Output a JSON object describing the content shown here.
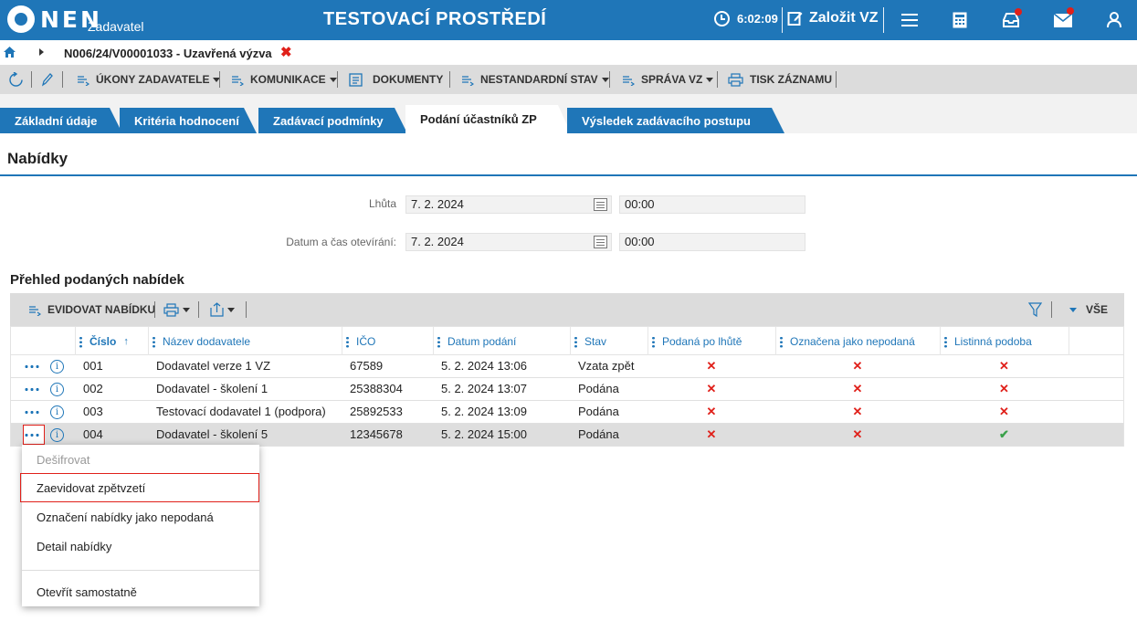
{
  "header": {
    "logo_text": "NEN",
    "logo_sub": "Zadavatel",
    "env_title": "TESTOVACÍ PROSTŘEDÍ",
    "time": "6:02:09",
    "create_label": "Založit VZ"
  },
  "breadcrumb": {
    "text": "N006/24/V00001033 - Uzavřená výzva",
    "close": "✖"
  },
  "toolbar": {
    "ukony": "ÚKONY ZADAVATELE",
    "komunikace": "KOMUNIKACE",
    "dokumenty": "DOKUMENTY",
    "nestandardni": "NESTANDARDNÍ STAV",
    "sprava": "SPRÁVA VZ",
    "tisk": "TISK ZÁZNAMU"
  },
  "tabs": [
    {
      "label": "Základní údaje"
    },
    {
      "label": "Kritéria hodnocení"
    },
    {
      "label": "Zadávací podmínky"
    },
    {
      "label": "Podání účastníků ZP"
    },
    {
      "label": "Výsledek zadávacího postupu"
    }
  ],
  "section": {
    "title": "Nabídky",
    "lhuta_label": "Lhůta",
    "lhuta_date": "7. 2. 2024",
    "lhuta_time": "00:00",
    "otevirani_label": "Datum a čas otevírání:",
    "otevirani_date": "7. 2. 2024",
    "otevirani_time": "00:00",
    "list_title": "Přehled podaných nabídek"
  },
  "grid_toolbar": {
    "evidovat": "EVIDOVAT NABÍDKU",
    "filter_all": "VŠE"
  },
  "columns": {
    "cislo": "Číslo",
    "nazev": "Název dodavatele",
    "ico": "IČO",
    "datum": "Datum podání",
    "stav": "Stav",
    "po_lhute": "Podaná po lhůtě",
    "nepodana": "Označena jako nepodaná",
    "listinna": "Listinná podoba"
  },
  "rows": [
    {
      "cislo": "001",
      "nazev": "Dodavatel verze 1 VZ",
      "ico": "67589",
      "datum": "5. 2. 2024 13:06",
      "stav": "Vzata zpět",
      "po_lhute": "✕",
      "nepodana": "✕",
      "listinna": "✕"
    },
    {
      "cislo": "002",
      "nazev": "Dodavatel - školení 1",
      "ico": "25388304",
      "datum": "5. 2. 2024 13:07",
      "stav": "Podána",
      "po_lhute": "✕",
      "nepodana": "✕",
      "listinna": "✕"
    },
    {
      "cislo": "003",
      "nazev": "Testovací dodavatel 1 (podpora)",
      "ico": "25892533",
      "datum": "5. 2. 2024 13:09",
      "stav": "Podána",
      "po_lhute": "✕",
      "nepodana": "✕",
      "listinna": "✕"
    },
    {
      "cislo": "004",
      "nazev": "Dodavatel - školení 5",
      "ico": "12345678",
      "datum": "5. 2. 2024 15:00",
      "stav": "Podána",
      "po_lhute": "✕",
      "nepodana": "✕",
      "listinna": "✔"
    }
  ],
  "context_menu": {
    "desifrovat": "Dešifrovat",
    "zaevidovat": "Zaevidovat zpětvzetí",
    "oznaceni": "Označení nabídky jako nepodaná",
    "detail": "Detail nabídky",
    "otevrit": "Otevřít samostatně"
  },
  "colors": {
    "primary": "#1f76b8",
    "toolbar_bg": "#dcdcdc",
    "red": "#e0201a",
    "green": "#3aa14a"
  }
}
